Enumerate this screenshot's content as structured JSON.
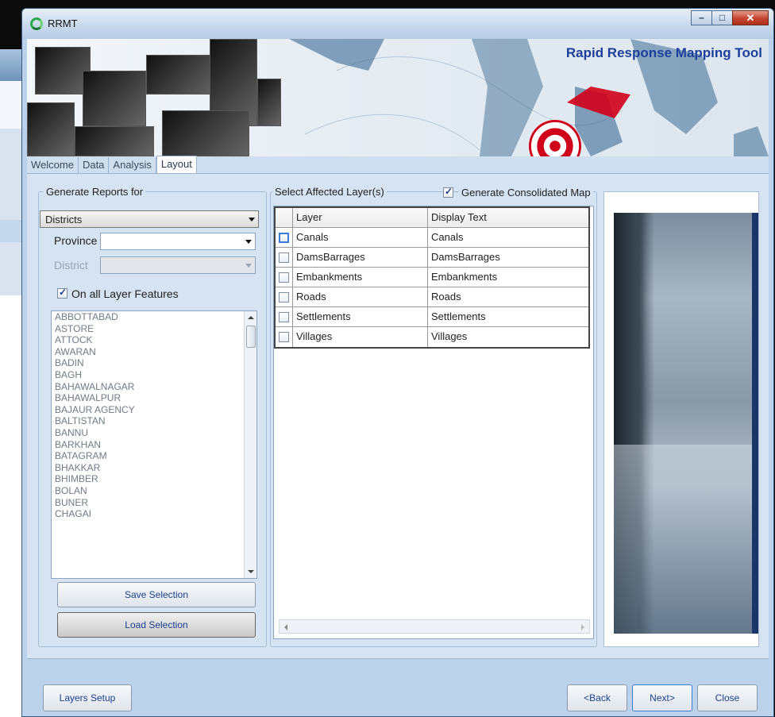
{
  "window": {
    "title": "RRMT"
  },
  "banner": {
    "title": "Rapid Response Mapping Tool"
  },
  "tabs": [
    {
      "label": "Welcome"
    },
    {
      "label": "Data"
    },
    {
      "label": "Analysis"
    },
    {
      "label": "Layout"
    }
  ],
  "reports": {
    "group_label": "Generate Reports for",
    "report_type": "Districts",
    "province_label": "Province",
    "province_value": "",
    "district_label": "District",
    "district_value": "",
    "all_features_label": "On all Layer Features",
    "all_features_checked": true,
    "districts": [
      "ABBOTTABAD",
      "ASTORE",
      "ATTOCK",
      "AWARAN",
      "BADIN",
      "BAGH",
      "BAHAWALNAGAR",
      "BAHAWALPUR",
      "BAJAUR AGENCY",
      "BALTISTAN",
      "BANNU",
      "BARKHAN",
      "BATAGRAM",
      "BHAKKAR",
      "BHIMBER",
      "BOLAN",
      "BUNER",
      "CHAGAI"
    ],
    "save_label": "Save Selection",
    "load_label": "Load Selection"
  },
  "layers": {
    "group_label": "Select Affected Layer(s)",
    "consolidated_label": "Generate Consolidated Map",
    "consolidated_checked": true,
    "headers": {
      "layer": "Layer",
      "display": "Display Text"
    },
    "rows": [
      {
        "layer": "Canals",
        "display": "Canals"
      },
      {
        "layer": "DamsBarrages",
        "display": "DamsBarrages"
      },
      {
        "layer": "Embankments",
        "display": "Embankments"
      },
      {
        "layer": "Roads",
        "display": "Roads"
      },
      {
        "layer": "Settlements",
        "display": "Settlements"
      },
      {
        "layer": "Villages",
        "display": "Villages"
      }
    ]
  },
  "footer": {
    "layers_setup": "Layers Setup",
    "back": "<Back",
    "next": "Next>",
    "close": "Close"
  },
  "colors": {
    "accent": "#1d3f9a",
    "window_frame": "#bcd2ea",
    "panel": "#d6e3f2"
  },
  "icons": [
    "app-icon",
    "minimize-icon",
    "maximize-icon",
    "close-icon",
    "chevron-down-icon",
    "check-icon",
    "target-icon"
  ]
}
